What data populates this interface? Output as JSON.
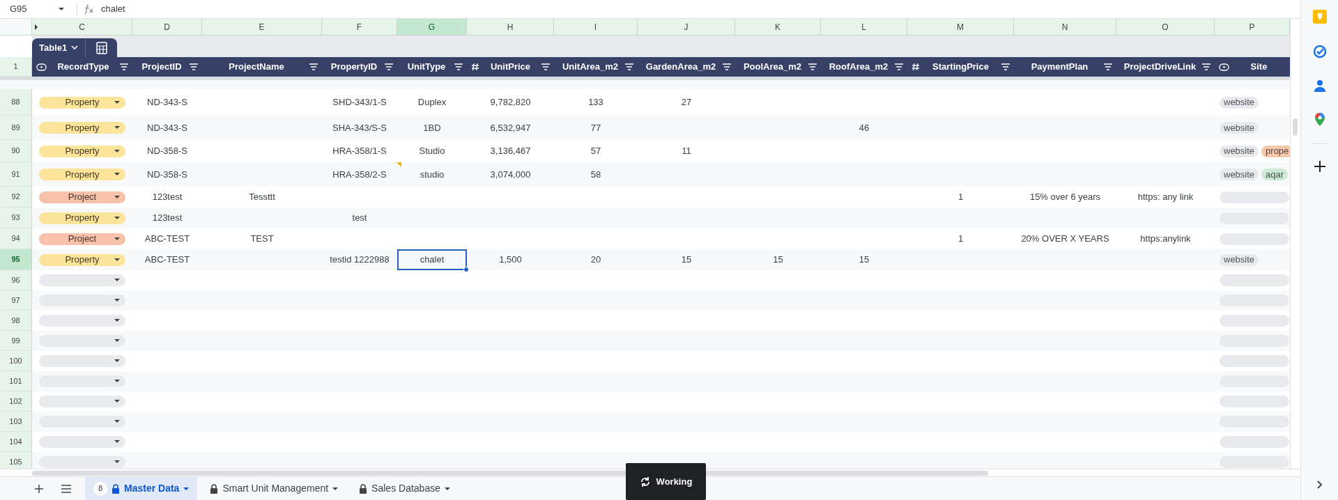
{
  "formula_bar": {
    "cell_ref": "G95",
    "formula": "chalet"
  },
  "column_letters": [
    {
      "label": "C",
      "selected": false
    },
    {
      "label": "D",
      "selected": false
    },
    {
      "label": "E",
      "selected": false
    },
    {
      "label": "F",
      "selected": false
    },
    {
      "label": "G",
      "selected": true
    },
    {
      "label": "H",
      "selected": false
    },
    {
      "label": "I",
      "selected": false
    },
    {
      "label": "J",
      "selected": false
    },
    {
      "label": "K",
      "selected": false
    },
    {
      "label": "L",
      "selected": false
    },
    {
      "label": "M",
      "selected": false
    },
    {
      "label": "N",
      "selected": false
    },
    {
      "label": "O",
      "selected": false
    },
    {
      "label": "P",
      "selected": false
    }
  ],
  "table": {
    "name": "Table1",
    "header_row_number": "1",
    "columns": [
      {
        "label": "RecordType",
        "kind": "dropdown",
        "filter": true
      },
      {
        "label": "ProjectID",
        "kind": "text",
        "filter": true
      },
      {
        "label": "ProjectName",
        "kind": "text",
        "filter": true
      },
      {
        "label": "PropertyID",
        "kind": "text",
        "filter": true
      },
      {
        "label": "UnitType",
        "kind": "text",
        "filter": true
      },
      {
        "label": "UnitPrice",
        "kind": "number",
        "filter": true
      },
      {
        "label": "UnitArea_m2",
        "kind": "text",
        "filter": true
      },
      {
        "label": "GardenArea_m2",
        "kind": "text",
        "filter": true
      },
      {
        "label": "PoolArea_m2",
        "kind": "text",
        "filter": true
      },
      {
        "label": "RoofArea_m2",
        "kind": "text",
        "filter": true
      },
      {
        "label": "StartingPrice",
        "kind": "number",
        "filter": true
      },
      {
        "label": "PaymentPlan",
        "kind": "text",
        "filter": true
      },
      {
        "label": "ProjectDriveLink",
        "kind": "text",
        "filter": true
      },
      {
        "label": "Site",
        "kind": "dropdown",
        "filter": false
      }
    ],
    "rows": [
      {
        "row_number": "88",
        "selected": false,
        "note": false,
        "record_type": {
          "label": "Property",
          "color": "#fde49b"
        },
        "cells": [
          "ND-343-S",
          null,
          "SHD-343/1-S",
          "Duplex",
          "9,782,820",
          "133",
          "27",
          null,
          null,
          null,
          null,
          null
        ],
        "site_tags": [
          {
            "label": "website",
            "color": "#e8eaed"
          }
        ]
      },
      {
        "row_number": "89",
        "selected": false,
        "note": false,
        "record_type": {
          "label": "Property",
          "color": "#fde49b"
        },
        "cells": [
          "ND-343-S",
          null,
          "SHA-343/S-S",
          "1BD",
          "6,532,947",
          "77",
          null,
          null,
          "46",
          null,
          null,
          null
        ],
        "site_tags": [
          {
            "label": "website",
            "color": "#e8eaed"
          }
        ]
      },
      {
        "row_number": "90",
        "selected": false,
        "note": false,
        "record_type": {
          "label": "Property",
          "color": "#fde49b"
        },
        "cells": [
          "ND-358-S",
          null,
          "HRA-358/1-S",
          "Studio",
          "3,136,467",
          "57",
          "11",
          null,
          null,
          null,
          null,
          null
        ],
        "site_tags": [
          {
            "label": "website",
            "color": "#e8eaed"
          },
          {
            "label": "prope",
            "color": "#f6c9ad"
          }
        ]
      },
      {
        "row_number": "91",
        "selected": false,
        "note": true,
        "record_type": {
          "label": "Property",
          "color": "#fde49b"
        },
        "cells": [
          "ND-358-S",
          null,
          "HRA-358/2-S",
          "studio",
          "3,074,000",
          "58",
          null,
          null,
          null,
          null,
          null,
          null
        ],
        "site_tags": [
          {
            "label": "website",
            "color": "#e8eaed"
          },
          {
            "label": "aqar",
            "color": "#ceead6"
          }
        ]
      },
      {
        "row_number": "92",
        "selected": false,
        "note": false,
        "record_type": {
          "label": "Project",
          "color": "#f8c2aa"
        },
        "cells": [
          "123test",
          "Tessttt",
          null,
          null,
          null,
          null,
          null,
          null,
          null,
          "1",
          "15% over 6 years",
          "https: any link"
        ]
      },
      {
        "row_number": "93",
        "selected": false,
        "note": false,
        "record_type": {
          "label": "Property",
          "color": "#fde49b"
        },
        "cells": [
          "123test",
          null,
          "test",
          null,
          null,
          null,
          null,
          null,
          null,
          null,
          null,
          null
        ]
      },
      {
        "row_number": "94",
        "selected": false,
        "note": false,
        "record_type": {
          "label": "Project",
          "color": "#f8c2aa"
        },
        "cells": [
          "ABC-TEST",
          "TEST",
          null,
          null,
          null,
          null,
          null,
          null,
          null,
          "1",
          "20% OVER X YEARS",
          "https:anylink"
        ]
      },
      {
        "row_number": "95",
        "selected": true,
        "note": false,
        "record_type": {
          "label": "Property",
          "color": "#fde49b"
        },
        "cells": [
          "ABC-TEST",
          null,
          "testid 1222988",
          "chalet",
          "1,500",
          "20",
          "15",
          "15",
          "15",
          null,
          null,
          null
        ],
        "site_tags": [
          {
            "label": "website",
            "color": "#e8eaed"
          }
        ]
      },
      {
        "row_number": "96",
        "selected": false,
        "note": false
      },
      {
        "row_number": "97",
        "selected": false,
        "note": false
      },
      {
        "row_number": "98",
        "selected": false,
        "note": false
      },
      {
        "row_number": "99",
        "selected": false,
        "note": false
      },
      {
        "row_number": "100",
        "selected": false,
        "note": false
      },
      {
        "row_number": "101",
        "selected": false,
        "note": false
      },
      {
        "row_number": "102",
        "selected": false,
        "note": false
      },
      {
        "row_number": "103",
        "selected": false,
        "note": false
      },
      {
        "row_number": "104",
        "selected": false,
        "note": false
      },
      {
        "row_number": "105",
        "selected": false,
        "note": false
      }
    ]
  },
  "sheet_tabs": [
    {
      "label": "Master Data",
      "selected": true,
      "locked": true,
      "count": "8"
    },
    {
      "label": "Smart Unit Management",
      "selected": false,
      "locked": true
    },
    {
      "label": "Sales Database",
      "selected": false,
      "locked": true
    }
  ],
  "toast": {
    "text": "Working"
  }
}
